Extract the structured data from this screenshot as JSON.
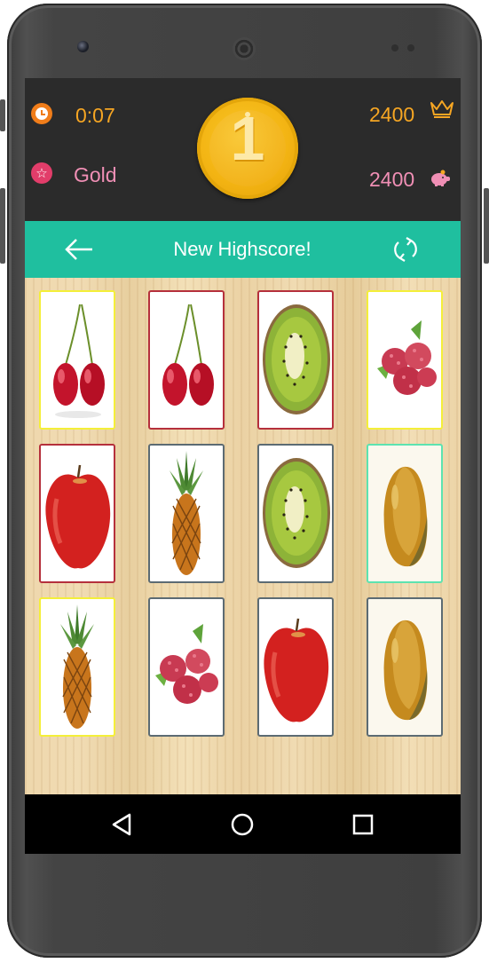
{
  "stats": {
    "time": "0:07",
    "rank": "Gold",
    "best_score": "2400",
    "score": "2400",
    "level_badge": "1"
  },
  "toolbar": {
    "title": "New Highscore!"
  },
  "icons": {
    "clock": "clock-icon",
    "rank": "star-icon",
    "best": "crown-icon",
    "score": "piggy-bank-icon",
    "back": "arrow-left-icon",
    "restart": "refresh-icon",
    "nav_back": "triangle-back-icon",
    "nav_home": "circle-home-icon",
    "nav_recents": "square-recents-icon"
  },
  "colors": {
    "topbar": "#2b2b2b",
    "toolbar": "#1fbf9f",
    "time_text": "#f6a623",
    "rank_text": "#f08fb5",
    "coin": "#f3b413",
    "card_selected": "#f4ef39",
    "card_matched": "#b5303c",
    "card_hint": "#5de3b0",
    "card_default": "#5c6b73"
  },
  "cards": [
    {
      "fruit": "cherries",
      "state": "selected"
    },
    {
      "fruit": "cherries",
      "state": "matched"
    },
    {
      "fruit": "kiwi",
      "state": "matched"
    },
    {
      "fruit": "raspberries",
      "state": "selected"
    },
    {
      "fruit": "apple",
      "state": "matched"
    },
    {
      "fruit": "pineapple",
      "state": "default"
    },
    {
      "fruit": "kiwi",
      "state": "default"
    },
    {
      "fruit": "mango",
      "state": "hint"
    },
    {
      "fruit": "pineapple",
      "state": "selected"
    },
    {
      "fruit": "raspberries",
      "state": "default"
    },
    {
      "fruit": "apple",
      "state": "default"
    },
    {
      "fruit": "mango",
      "state": "default"
    }
  ]
}
